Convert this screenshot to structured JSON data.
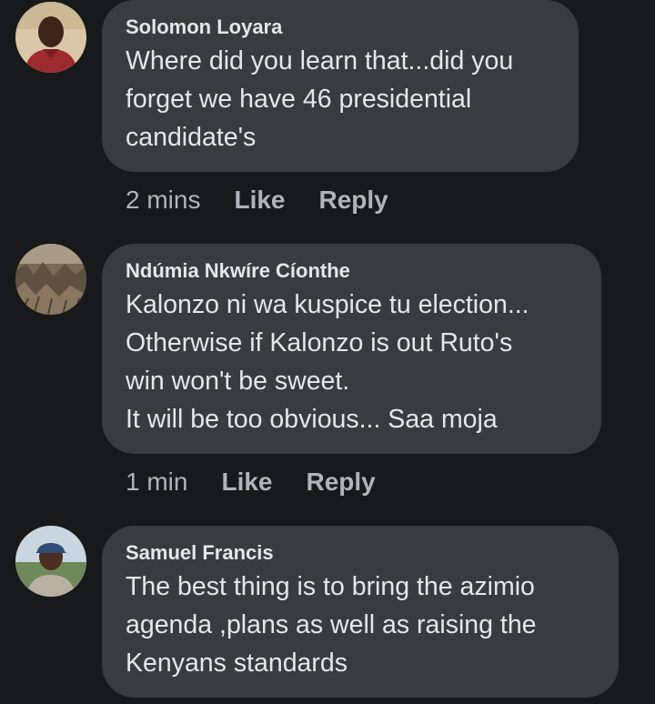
{
  "comments": [
    {
      "author": "Solomon Loyara",
      "text": "Where did you learn that...did you\nforget we have 46 presidential\ncandidate's",
      "time": "2 mins",
      "like_label": "Like",
      "reply_label": "Reply",
      "avatar_icon": "user-photo-man-red-shirt"
    },
    {
      "author": "Ndúmia Nkwíre Cíonthe",
      "text": "Kalonzo ni wa kuspice tu election...\nOtherwise if Kalonzo is out  Ruto's\nwin won't be sweet.\nIt will be too obvious... Saa moja",
      "time": "1 min",
      "like_label": "Like",
      "reply_label": "Reply",
      "avatar_icon": "user-photo-grass-field"
    },
    {
      "author": "Samuel Francis",
      "text": "The best thing is to  bring the azimio\nagenda ,plans as well as raising the\nKenyans standards",
      "avatar_icon": "user-photo-man-cap"
    }
  ],
  "colors": {
    "background": "#18191a",
    "bubble": "#3a3b3c",
    "primary_text": "#e4e6eb",
    "secondary_text": "#b0b3b8"
  }
}
